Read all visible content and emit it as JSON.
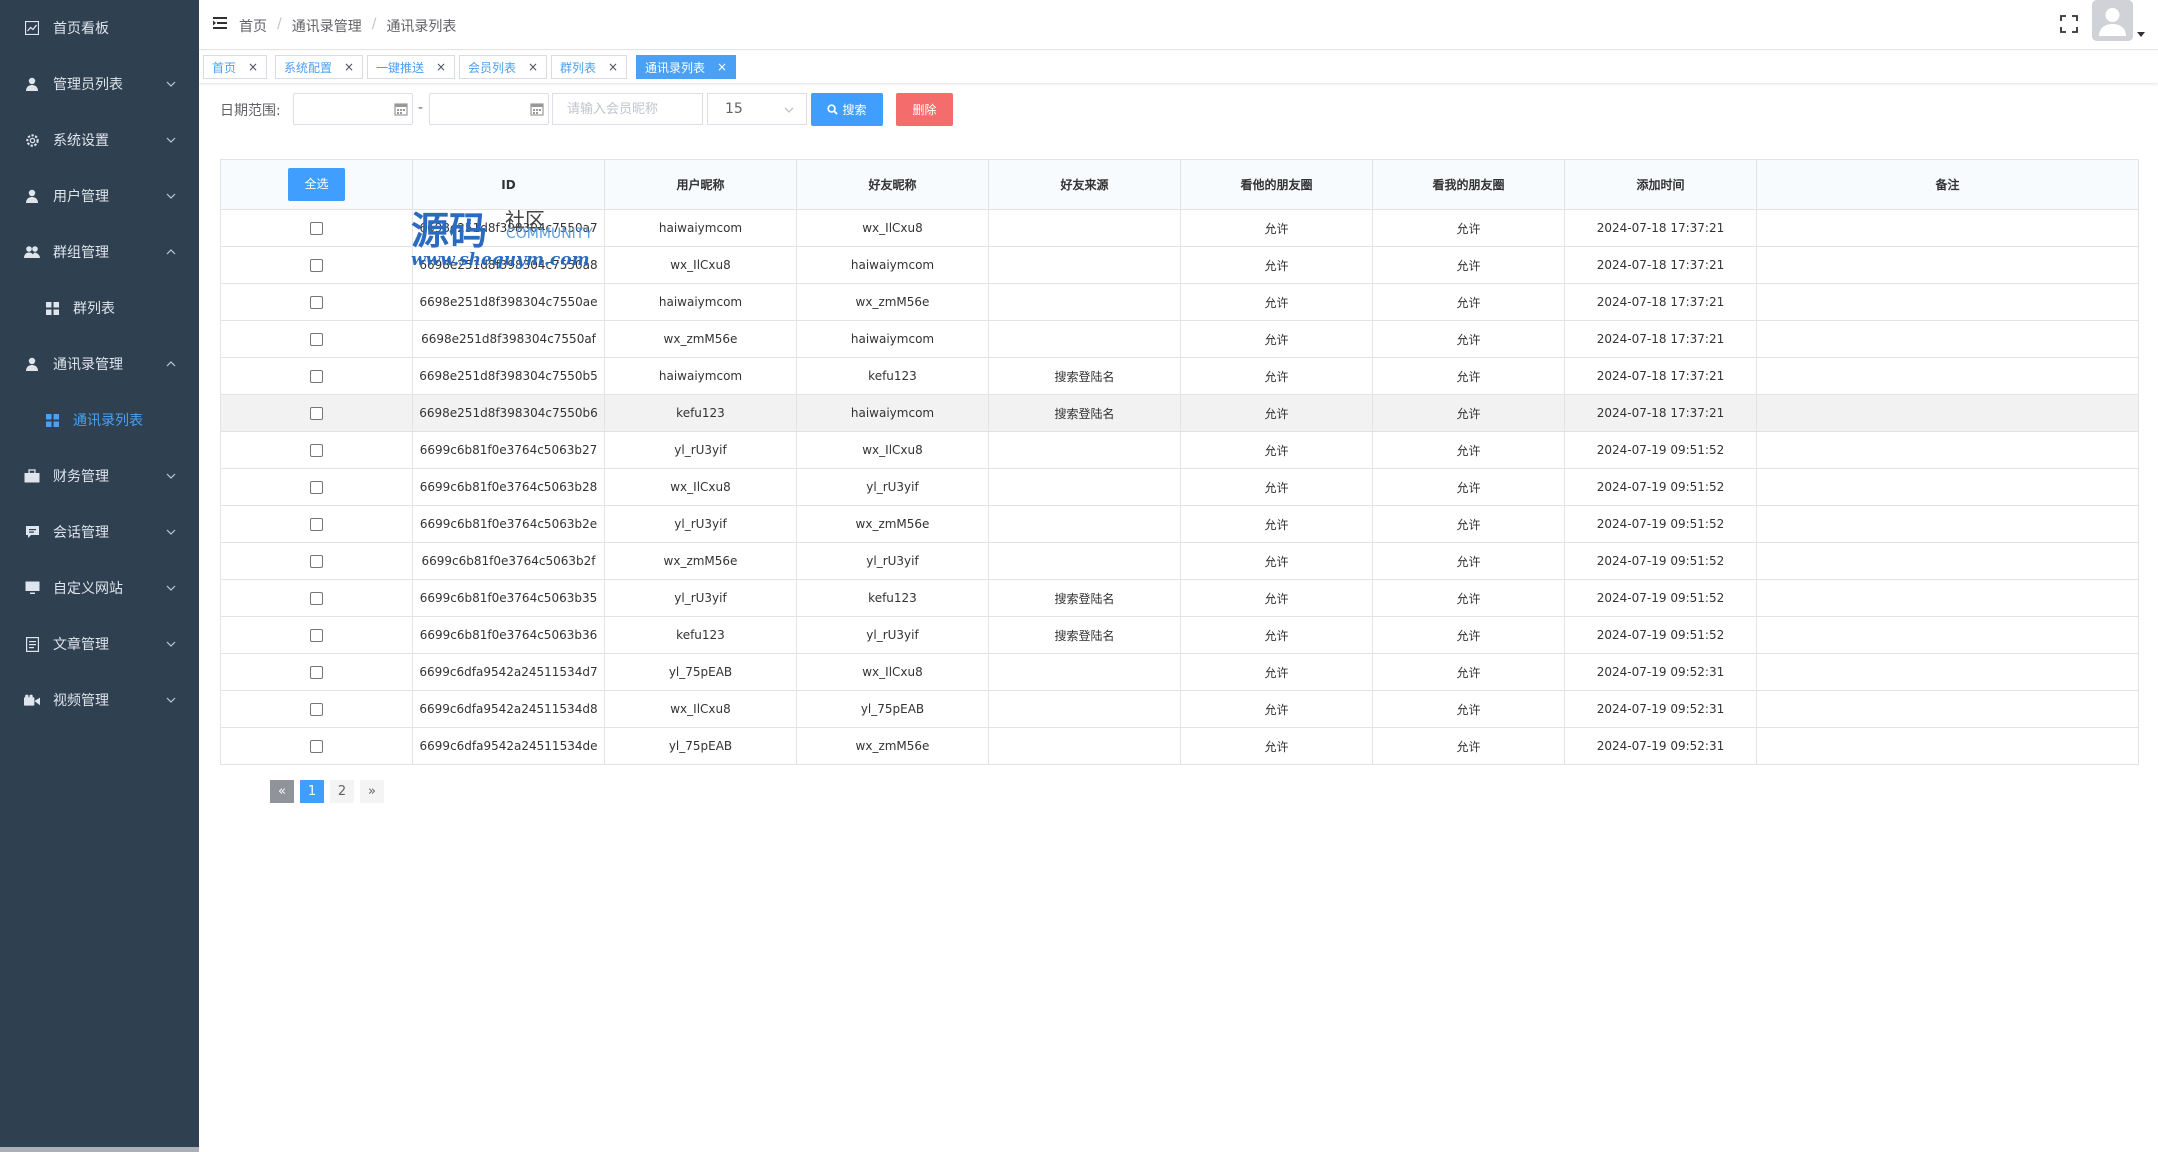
{
  "sidebar": {
    "items": [
      {
        "label": "首页看板",
        "icon": "dashboard-icon",
        "has_arrow": false
      },
      {
        "label": "管理员列表",
        "icon": "user-icon",
        "has_arrow": true
      },
      {
        "label": "系统设置",
        "icon": "gear-icon",
        "has_arrow": true
      },
      {
        "label": "用户管理",
        "icon": "user-icon",
        "has_arrow": true
      },
      {
        "label": "群组管理",
        "icon": "group-icon",
        "has_arrow": true,
        "expanded": true
      },
      {
        "label": "群列表",
        "icon": "grid-icon",
        "sub": true
      },
      {
        "label": "通讯录管理",
        "icon": "user-icon",
        "has_arrow": true,
        "expanded": true
      },
      {
        "label": "通讯录列表",
        "icon": "grid-icon",
        "sub": true,
        "active": true
      },
      {
        "label": "财务管理",
        "icon": "briefcase-icon",
        "has_arrow": true
      },
      {
        "label": "会话管理",
        "icon": "chat-icon",
        "has_arrow": true
      },
      {
        "label": "自定义网站",
        "icon": "monitor-icon",
        "has_arrow": true
      },
      {
        "label": "文章管理",
        "icon": "document-icon",
        "has_arrow": true
      },
      {
        "label": "视频管理",
        "icon": "video-icon",
        "has_arrow": true
      }
    ]
  },
  "header": {
    "breadcrumb": [
      "首页",
      "通讯录管理",
      "通讯录列表"
    ],
    "separator": "/"
  },
  "tags": [
    {
      "label": "首页",
      "close": "×"
    },
    {
      "label": "系统配置",
      "close": "×"
    },
    {
      "label": "一键推送",
      "close": "×"
    },
    {
      "label": "会员列表",
      "close": "×"
    },
    {
      "label": "群列表",
      "close": "×"
    },
    {
      "label": "通讯录列表",
      "close": "×",
      "active": true
    }
  ],
  "filter": {
    "date_label": "日期范围:",
    "dash": "-",
    "search_placeholder": "请输入会员昵称",
    "page_size": "15",
    "search_button": "搜索",
    "delete_button": "删除"
  },
  "table": {
    "select_all": "全选",
    "columns": [
      "ID",
      "用户昵称",
      "好友昵称",
      "好友来源",
      "看他的朋友圈",
      "看我的朋友圈",
      "添加时间",
      "备注"
    ],
    "rows": [
      [
        "6698e251d8f398304c7550a7",
        "haiwaiymcom",
        "wx_IlCxu8",
        "",
        "允许",
        "允许",
        "2024-07-18 17:37:21",
        ""
      ],
      [
        "6698e251d8f398304c7550a8",
        "wx_IlCxu8",
        "haiwaiymcom",
        "",
        "允许",
        "允许",
        "2024-07-18 17:37:21",
        ""
      ],
      [
        "6698e251d8f398304c7550ae",
        "haiwaiymcom",
        "wx_zmM56e",
        "",
        "允许",
        "允许",
        "2024-07-18 17:37:21",
        ""
      ],
      [
        "6698e251d8f398304c7550af",
        "wx_zmM56e",
        "haiwaiymcom",
        "",
        "允许",
        "允许",
        "2024-07-18 17:37:21",
        ""
      ],
      [
        "6698e251d8f398304c7550b5",
        "haiwaiymcom",
        "kefu123",
        "搜索登陆名",
        "允许",
        "允许",
        "2024-07-18 17:37:21",
        ""
      ],
      [
        "6698e251d8f398304c7550b6",
        "kefu123",
        "haiwaiymcom",
        "搜索登陆名",
        "允许",
        "允许",
        "2024-07-18 17:37:21",
        ""
      ],
      [
        "6699c6b81f0e3764c5063b27",
        "yl_rU3yif",
        "wx_IlCxu8",
        "",
        "允许",
        "允许",
        "2024-07-19 09:51:52",
        ""
      ],
      [
        "6699c6b81f0e3764c5063b28",
        "wx_IlCxu8",
        "yl_rU3yif",
        "",
        "允许",
        "允许",
        "2024-07-19 09:51:52",
        ""
      ],
      [
        "6699c6b81f0e3764c5063b2e",
        "yl_rU3yif",
        "wx_zmM56e",
        "",
        "允许",
        "允许",
        "2024-07-19 09:51:52",
        ""
      ],
      [
        "6699c6b81f0e3764c5063b2f",
        "wx_zmM56e",
        "yl_rU3yif",
        "",
        "允许",
        "允许",
        "2024-07-19 09:51:52",
        ""
      ],
      [
        "6699c6b81f0e3764c5063b35",
        "yl_rU3yif",
        "kefu123",
        "搜索登陆名",
        "允许",
        "允许",
        "2024-07-19 09:51:52",
        ""
      ],
      [
        "6699c6b81f0e3764c5063b36",
        "kefu123",
        "yl_rU3yif",
        "搜索登陆名",
        "允许",
        "允许",
        "2024-07-19 09:51:52",
        ""
      ],
      [
        "6699c6dfa9542a24511534d7",
        "yl_75pEAB",
        "wx_IlCxu8",
        "",
        "允许",
        "允许",
        "2024-07-19 09:52:31",
        ""
      ],
      [
        "6699c6dfa9542a24511534d8",
        "wx_IlCxu8",
        "yl_75pEAB",
        "",
        "允许",
        "允许",
        "2024-07-19 09:52:31",
        ""
      ],
      [
        "6699c6dfa9542a24511534de",
        "yl_75pEAB",
        "wx_zmM56e",
        "",
        "允许",
        "允许",
        "2024-07-19 09:52:31",
        ""
      ]
    ],
    "highlighted_row": 5
  },
  "pagination": {
    "prev": "«",
    "pages": [
      "1",
      "2"
    ],
    "active": "1",
    "next": "»"
  },
  "watermark": {
    "big": "源码",
    "small": "社区",
    "community": "COMMUNITY",
    "url": "www.shequym.com"
  },
  "colors": {
    "sidebar_bg": "#2f4050",
    "primary": "#409eff",
    "danger": "#f56c6c",
    "active_menu": "#4aa0f5"
  }
}
